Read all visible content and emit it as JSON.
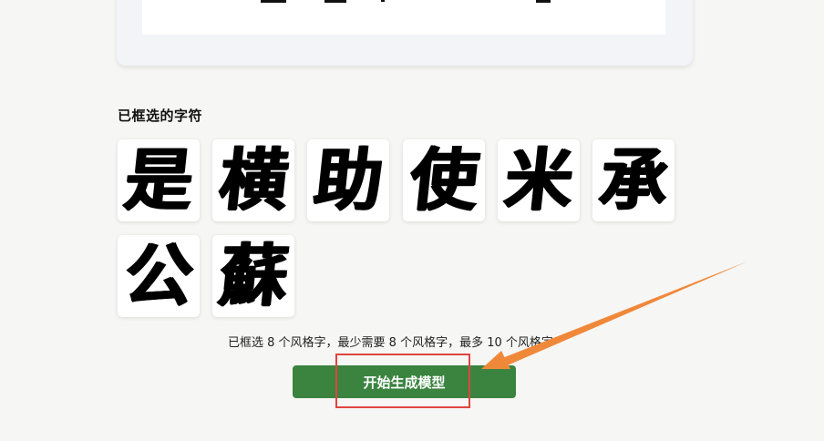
{
  "upload_card": {},
  "selected_section": {
    "title": "已框选的字符",
    "characters": [
      "是",
      "横",
      "助",
      "使",
      "米",
      "承",
      "公",
      "蘇"
    ]
  },
  "status": {
    "text": "已框选 8 个风格字，最少需要 8 个风格字，最多 10 个风格字"
  },
  "actions": {
    "start_label": "开始生成模型"
  },
  "colors": {
    "button_bg": "#3a8440",
    "highlight_border": "#e0453f",
    "arrow": "#f0883a",
    "page_bg": "#f6f6f4"
  }
}
